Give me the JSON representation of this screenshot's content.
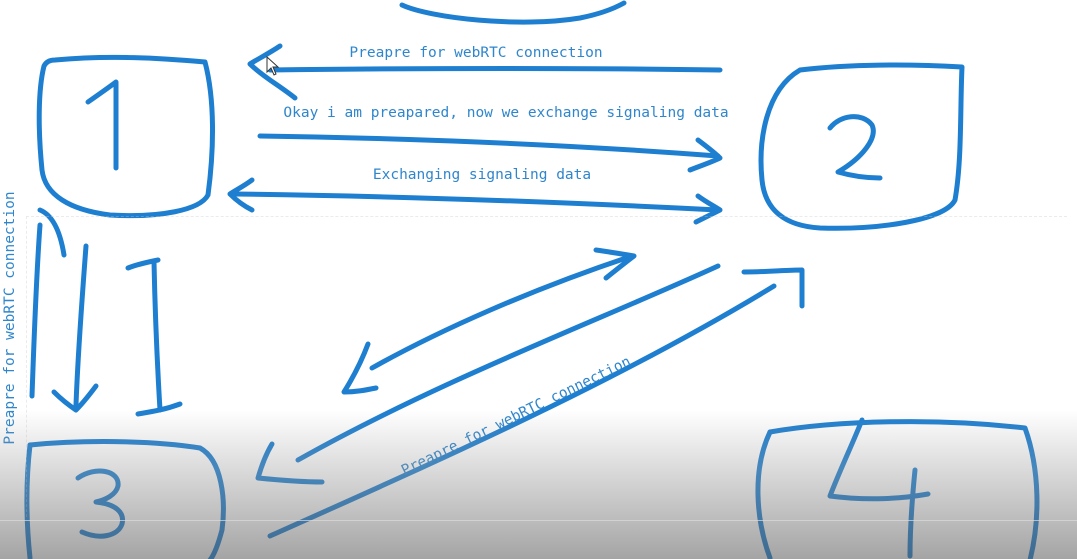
{
  "colors": {
    "ink": "#1e7fd0",
    "label": "#2f86cc"
  },
  "nodes": [
    {
      "id": "1",
      "label": "1"
    },
    {
      "id": "2",
      "label": "2"
    },
    {
      "id": "3",
      "label": "3"
    },
    {
      "id": "4",
      "label": "4"
    }
  ],
  "edges": [
    {
      "from": "2",
      "to": "1",
      "label": "Preapre for webRTC connection"
    },
    {
      "from": "1",
      "to": "2",
      "label": "Okay i am preapared, now we exchange signaling data"
    },
    {
      "from": "1",
      "to": "2",
      "label": "Exchanging signaling data",
      "bidirectional": true
    },
    {
      "from": "1",
      "to": "3",
      "label": "Preapre for webRTC connection"
    },
    {
      "from": "2",
      "to": "3",
      "label": "Preapre for webRTC connection"
    }
  ]
}
